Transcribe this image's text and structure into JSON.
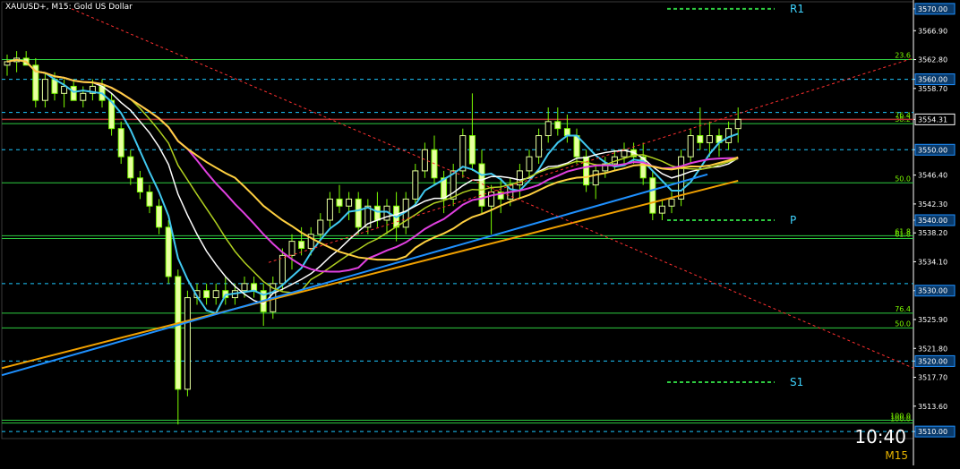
{
  "chart_data": {
    "type": "candlestick",
    "symbol_line": "XAUUSD+, M15:  Gold US Dollar",
    "clock": "10:40",
    "timeframe": "M15",
    "ylim": [
      3509.0,
      3571.0
    ],
    "y_ticks": [
      "3570.00",
      "3566.90",
      "3562.80",
      "3560.00",
      "3558.70",
      "3554.31",
      "3550.00",
      "3546.40",
      "3542.30",
      "3540.00",
      "3538.20",
      "3534.10",
      "3530.00",
      "3525.90",
      "3521.80",
      "3520.00",
      "3517.70",
      "3513.60",
      "3510.00"
    ],
    "highlight_ticks": [
      "3570.00",
      "3560.00",
      "3554.31",
      "3550.00",
      "3540.00",
      "3530.00",
      "3520.00",
      "3510.00"
    ],
    "current_price": 3554.31,
    "horizontal_levels": [
      {
        "price": 3570.0,
        "style": "pivot",
        "label": "R1"
      },
      {
        "price": 3560.0,
        "style": "dashed"
      },
      {
        "price": 3555.3,
        "style": "dashed"
      },
      {
        "price": 3550.0,
        "style": "dashed"
      },
      {
        "price": 3540.0,
        "style": "pivot",
        "label": "P"
      },
      {
        "price": 3531.0,
        "style": "dashed"
      },
      {
        "price": 3520.0,
        "style": "dashed"
      },
      {
        "price": 3517.0,
        "style": "pivot",
        "label": "S1"
      },
      {
        "price": 3510.0,
        "style": "dashed"
      }
    ],
    "fib_levels": [
      {
        "price": 3562.8,
        "label": "23.6"
      },
      {
        "price": 3554.31,
        "label": "76.4"
      },
      {
        "price": 3553.7,
        "label": "38.2"
      },
      {
        "price": 3545.3,
        "label": "50.0"
      },
      {
        "price": 3537.8,
        "label": "61.8"
      },
      {
        "price": 3537.4,
        "label": "61.8"
      },
      {
        "price": 3526.8,
        "label": "76.4"
      },
      {
        "price": 3524.7,
        "label": "50.0"
      },
      {
        "price": 3511.6,
        "label": "100.0"
      },
      {
        "price": 3511.2,
        "label": "100.0"
      }
    ],
    "candles": [
      {
        "o": 3562,
        "h": 3563.5,
        "l": 3560.5,
        "c": 3562.5
      },
      {
        "o": 3562.5,
        "h": 3564,
        "l": 3561,
        "c": 3563
      },
      {
        "o": 3563,
        "h": 3564,
        "l": 3562,
        "c": 3562
      },
      {
        "o": 3562,
        "h": 3563,
        "l": 3556,
        "c": 3557
      },
      {
        "o": 3557,
        "h": 3561,
        "l": 3556,
        "c": 3560
      },
      {
        "o": 3560,
        "h": 3561,
        "l": 3557,
        "c": 3558
      },
      {
        "o": 3558,
        "h": 3560,
        "l": 3556,
        "c": 3559
      },
      {
        "o": 3559,
        "h": 3560,
        "l": 3557,
        "c": 3557
      },
      {
        "o": 3557,
        "h": 3559,
        "l": 3556,
        "c": 3558
      },
      {
        "o": 3558,
        "h": 3560,
        "l": 3557,
        "c": 3559
      },
      {
        "o": 3559,
        "h": 3560,
        "l": 3556,
        "c": 3557
      },
      {
        "o": 3557,
        "h": 3558,
        "l": 3552,
        "c": 3553
      },
      {
        "o": 3553,
        "h": 3554,
        "l": 3548,
        "c": 3549
      },
      {
        "o": 3549,
        "h": 3550,
        "l": 3545,
        "c": 3546
      },
      {
        "o": 3546,
        "h": 3547,
        "l": 3543,
        "c": 3544
      },
      {
        "o": 3544,
        "h": 3545,
        "l": 3541,
        "c": 3542
      },
      {
        "o": 3542,
        "h": 3543,
        "l": 3538,
        "c": 3539
      },
      {
        "o": 3539,
        "h": 3540,
        "l": 3531,
        "c": 3532
      },
      {
        "o": 3532,
        "h": 3533,
        "l": 3511,
        "c": 3516
      },
      {
        "o": 3516,
        "h": 3530,
        "l": 3515,
        "c": 3529
      },
      {
        "o": 3529,
        "h": 3531,
        "l": 3528,
        "c": 3530
      },
      {
        "o": 3530,
        "h": 3531,
        "l": 3528,
        "c": 3529
      },
      {
        "o": 3529,
        "h": 3531,
        "l": 3528,
        "c": 3530
      },
      {
        "o": 3530,
        "h": 3532,
        "l": 3528,
        "c": 3529
      },
      {
        "o": 3529,
        "h": 3531,
        "l": 3528,
        "c": 3530
      },
      {
        "o": 3530,
        "h": 3532,
        "l": 3529,
        "c": 3531
      },
      {
        "o": 3531,
        "h": 3532,
        "l": 3529,
        "c": 3530
      },
      {
        "o": 3530,
        "h": 3531,
        "l": 3525,
        "c": 3527
      },
      {
        "o": 3527,
        "h": 3532,
        "l": 3526,
        "c": 3531
      },
      {
        "o": 3531,
        "h": 3536,
        "l": 3530,
        "c": 3535
      },
      {
        "o": 3535,
        "h": 3538,
        "l": 3533,
        "c": 3537
      },
      {
        "o": 3537,
        "h": 3539,
        "l": 3535,
        "c": 3536
      },
      {
        "o": 3536,
        "h": 3539,
        "l": 3535,
        "c": 3538
      },
      {
        "o": 3538,
        "h": 3541,
        "l": 3537,
        "c": 3540
      },
      {
        "o": 3540,
        "h": 3544,
        "l": 3539,
        "c": 3543
      },
      {
        "o": 3543,
        "h": 3545,
        "l": 3541,
        "c": 3542
      },
      {
        "o": 3542,
        "h": 3544,
        "l": 3540,
        "c": 3543
      },
      {
        "o": 3543,
        "h": 3544,
        "l": 3538,
        "c": 3539
      },
      {
        "o": 3539,
        "h": 3543,
        "l": 3538,
        "c": 3542
      },
      {
        "o": 3542,
        "h": 3544,
        "l": 3539,
        "c": 3540
      },
      {
        "o": 3540,
        "h": 3543,
        "l": 3538,
        "c": 3542
      },
      {
        "o": 3542,
        "h": 3544,
        "l": 3537,
        "c": 3539
      },
      {
        "o": 3539,
        "h": 3544,
        "l": 3538,
        "c": 3543
      },
      {
        "o": 3543,
        "h": 3548,
        "l": 3542,
        "c": 3547
      },
      {
        "o": 3547,
        "h": 3551,
        "l": 3546,
        "c": 3550
      },
      {
        "o": 3550,
        "h": 3552,
        "l": 3545,
        "c": 3546
      },
      {
        "o": 3546,
        "h": 3547,
        "l": 3541,
        "c": 3543
      },
      {
        "o": 3543,
        "h": 3548,
        "l": 3542,
        "c": 3547
      },
      {
        "o": 3547,
        "h": 3553,
        "l": 3546,
        "c": 3552
      },
      {
        "o": 3552,
        "h": 3558,
        "l": 3547,
        "c": 3548
      },
      {
        "o": 3548,
        "h": 3550,
        "l": 3541,
        "c": 3542
      },
      {
        "o": 3542,
        "h": 3545,
        "l": 3538,
        "c": 3544
      },
      {
        "o": 3544,
        "h": 3546,
        "l": 3541,
        "c": 3543
      },
      {
        "o": 3543,
        "h": 3546,
        "l": 3542,
        "c": 3545
      },
      {
        "o": 3545,
        "h": 3548,
        "l": 3543,
        "c": 3547
      },
      {
        "o": 3547,
        "h": 3550,
        "l": 3546,
        "c": 3549
      },
      {
        "o": 3549,
        "h": 3553,
        "l": 3548,
        "c": 3552
      },
      {
        "o": 3552,
        "h": 3556,
        "l": 3551,
        "c": 3554
      },
      {
        "o": 3554,
        "h": 3556,
        "l": 3552,
        "c": 3553
      },
      {
        "o": 3553,
        "h": 3555,
        "l": 3551,
        "c": 3552
      },
      {
        "o": 3552,
        "h": 3553,
        "l": 3548,
        "c": 3549
      },
      {
        "o": 3549,
        "h": 3550,
        "l": 3544,
        "c": 3545
      },
      {
        "o": 3545,
        "h": 3548,
        "l": 3543,
        "c": 3547
      },
      {
        "o": 3547,
        "h": 3549,
        "l": 3546,
        "c": 3548
      },
      {
        "o": 3548,
        "h": 3550,
        "l": 3547,
        "c": 3549
      },
      {
        "o": 3549,
        "h": 3551,
        "l": 3548,
        "c": 3550
      },
      {
        "o": 3550,
        "h": 3551,
        "l": 3548,
        "c": 3549
      },
      {
        "o": 3549,
        "h": 3551,
        "l": 3545,
        "c": 3546
      },
      {
        "o": 3546,
        "h": 3547,
        "l": 3540,
        "c": 3541
      },
      {
        "o": 3541,
        "h": 3543,
        "l": 3540,
        "c": 3542
      },
      {
        "o": 3542,
        "h": 3544,
        "l": 3541,
        "c": 3543
      },
      {
        "o": 3543,
        "h": 3550,
        "l": 3542,
        "c": 3549
      },
      {
        "o": 3549,
        "h": 3553,
        "l": 3548,
        "c": 3552
      },
      {
        "o": 3552,
        "h": 3556,
        "l": 3550,
        "c": 3551
      },
      {
        "o": 3551,
        "h": 3554,
        "l": 3549,
        "c": 3552
      },
      {
        "o": 3552,
        "h": 3553,
        "l": 3549,
        "c": 3551
      },
      {
        "o": 3551,
        "h": 3554,
        "l": 3550,
        "c": 3553
      },
      {
        "o": 3553,
        "h": 3556,
        "l": 3551,
        "c": 3554.31
      }
    ],
    "x_start": 8,
    "x_step": 10.6
  }
}
